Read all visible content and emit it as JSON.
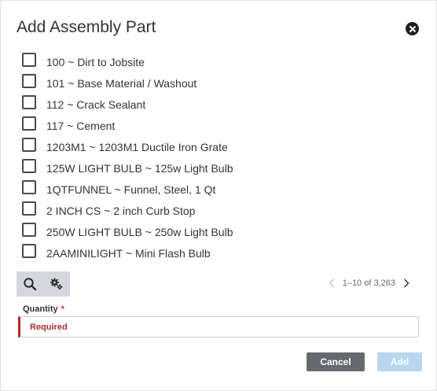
{
  "dialog": {
    "title": "Add Assembly Part"
  },
  "parts": [
    {
      "label": "100 ~ Dirt to Jobsite"
    },
    {
      "label": "101 ~ Base Material / Washout"
    },
    {
      "label": "112 ~ Crack Sealant"
    },
    {
      "label": "117 ~ Cement"
    },
    {
      "label": "1203M1 ~ 1203M1 Ductile Iron Grate"
    },
    {
      "label": "125W LIGHT BULB ~ 125w Light Bulb"
    },
    {
      "label": "1QTFUNNEL ~ Funnel, Steel, 1 Qt"
    },
    {
      "label": "2 INCH CS ~ 2 inch Curb Stop"
    },
    {
      "label": "250W LIGHT BULB ~ 250w Light Bulb"
    },
    {
      "label": "2AAMINILIGHT ~ Mini Flash Bulb"
    }
  ],
  "toolbar": {
    "search_icon": "search-icon",
    "settings_icon": "gears-icon"
  },
  "pager": {
    "range_text": "1–10 of 3,263"
  },
  "quantity": {
    "label": "Quantity",
    "required_mark": "*",
    "placeholder": "Required",
    "value": ""
  },
  "actions": {
    "cancel_label": "Cancel",
    "add_label": "Add"
  },
  "colors": {
    "cancel_bg": "#666a70",
    "add_bg_disabled": "#b9d6ee",
    "required_red": "#b32b2b",
    "toolbar_bg": "#d4d8de"
  }
}
